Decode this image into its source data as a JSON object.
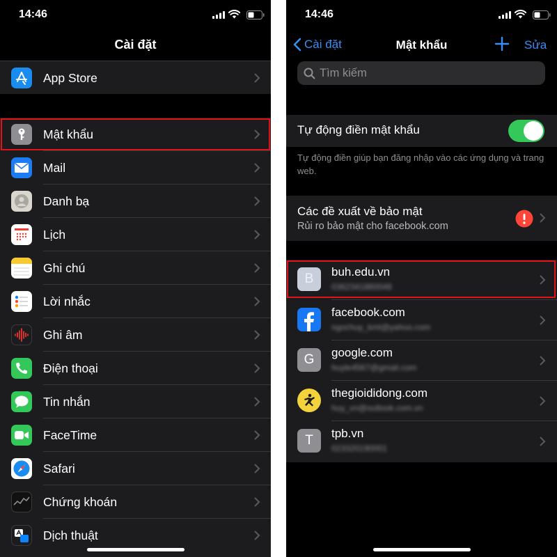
{
  "left": {
    "status_time": "14:46",
    "title": "Cài đặt",
    "items": [
      {
        "label": "App Store",
        "icon": "app-store-icon"
      },
      {
        "label": "Mật khẩu",
        "icon": "key-icon"
      },
      {
        "label": "Mail",
        "icon": "mail-icon"
      },
      {
        "label": "Danh bạ",
        "icon": "contacts-icon"
      },
      {
        "label": "Lịch",
        "icon": "calendar-icon"
      },
      {
        "label": "Ghi chú",
        "icon": "notes-icon"
      },
      {
        "label": "Lời nhắc",
        "icon": "reminders-icon"
      },
      {
        "label": "Ghi âm",
        "icon": "voice-memos-icon"
      },
      {
        "label": "Điện thoại",
        "icon": "phone-icon"
      },
      {
        "label": "Tin nhắn",
        "icon": "messages-icon"
      },
      {
        "label": "FaceTime",
        "icon": "facetime-icon"
      },
      {
        "label": "Safari",
        "icon": "safari-icon"
      },
      {
        "label": "Chứng khoán",
        "icon": "stocks-icon"
      },
      {
        "label": "Dịch thuật",
        "icon": "translate-icon"
      }
    ]
  },
  "right": {
    "status_time": "14:46",
    "back_label": "Cài đặt",
    "title": "Mật khẩu",
    "edit_label": "Sửa",
    "search_placeholder": "Tìm kiếm",
    "autofill_label": "Tự động điền mật khẩu",
    "autofill_on": true,
    "autofill_note": "Tự động điền giúp bạn đăng nhập vào các ứng dụng và trang web.",
    "security_title": "Các đề xuất về bảo mật",
    "security_subtitle": "Rủi ro bảo mật cho facebook.com",
    "accounts": [
      {
        "site": "buh.edu.vn",
        "user": "0362341860048",
        "letter": "B",
        "icon": "letter-b-icon"
      },
      {
        "site": "facebook.com",
        "user": "ngochuy_kmt@yahoo.com",
        "letter": "",
        "icon": "facebook-icon"
      },
      {
        "site": "google.com",
        "user": "huyle4567@gmail.com",
        "letter": "G",
        "icon": "letter-g-icon"
      },
      {
        "site": "thegioididong.com",
        "user": "huy_vn@outlook.com.vn",
        "letter": "",
        "icon": "thegioididong-icon"
      },
      {
        "site": "tpb.vn",
        "user": "023320190001",
        "letter": "T",
        "icon": "letter-t-icon"
      }
    ]
  },
  "colors": {
    "accent": "#3a8ef6",
    "highlight": "#e1141c",
    "toggle": "#34c759",
    "warning": "#ff453a"
  }
}
